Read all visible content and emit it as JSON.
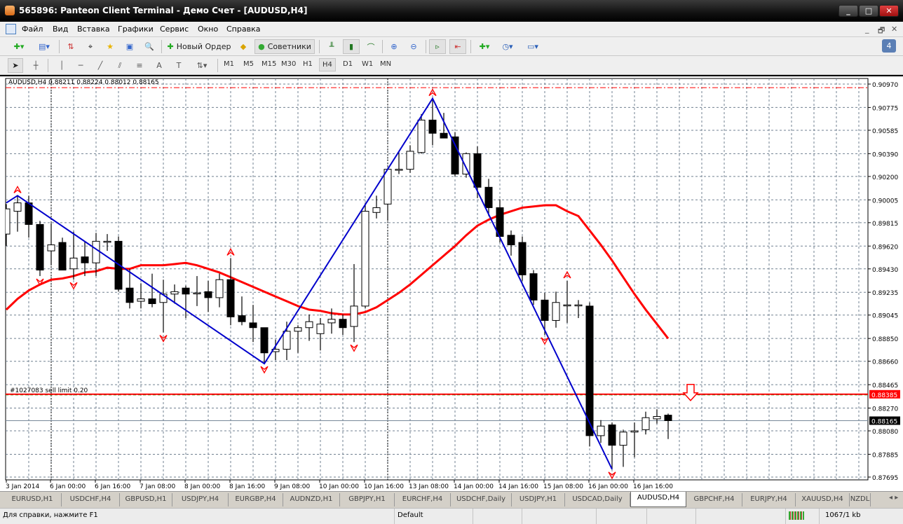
{
  "window": {
    "title": "565896: Panteon Client Terminal - Демо Счет - [AUDUSD,H4]",
    "minimize": "_",
    "maximize": "□",
    "close": "✕"
  },
  "menu": {
    "items": [
      "Файл",
      "Вид",
      "Вставка",
      "Графики",
      "Сервис",
      "Окно",
      "Справка"
    ],
    "child_controls": [
      "_",
      "🗗",
      "✕"
    ]
  },
  "toolbar": {
    "new_order": "Новый Ордер",
    "experts": "Советники",
    "notifications_count": "4"
  },
  "timeframes": [
    "M1",
    "M5",
    "M15",
    "M30",
    "H1",
    "H4",
    "D1",
    "W1",
    "MN"
  ],
  "active_timeframe": "H4",
  "colors": {
    "bull": "#ffffff",
    "bear": "#000000",
    "ma": "#ff0000",
    "zigzag": "#0000cc",
    "grid": "#708090",
    "order_line": "#ff0000"
  },
  "chart_data": {
    "type": "candlestick",
    "header": "AUDUSD,H4  0.88211 0.88224 0.88012 0.88165",
    "symbol": "AUDUSD,H4",
    "ylim": [
      0.87695,
      0.9097
    ],
    "y_ticks": [
      "0.90970",
      "0.90775",
      "0.90585",
      "0.90390",
      "0.90200",
      "0.90005",
      "0.89815",
      "0.89620",
      "0.89430",
      "0.89235",
      "0.89045",
      "0.88850",
      "0.88660",
      "0.88465",
      "0.88270",
      "0.88080",
      "0.87885",
      "0.87695"
    ],
    "x_ticks": [
      "3 Jan 2014",
      "6 Jan 00:00",
      "6 Jan 16:00",
      "7 Jan 08:00",
      "8 Jan 00:00",
      "8 Jan 16:00",
      "9 Jan 08:00",
      "10 Jan 00:00",
      "10 Jan 16:00",
      "13 Jan 08:00",
      "14 Jan 00:00",
      "14 Jan 16:00",
      "15 Jan 08:00",
      "16 Jan 00:00",
      "16 Jan 16:00"
    ],
    "candles_ohlc": [
      [
        0.8972,
        0.8997,
        0.8962,
        0.8993
      ],
      [
        0.8991,
        0.9004,
        0.8974,
        0.8998
      ],
      [
        0.8998,
        0.9004,
        0.8969,
        0.898
      ],
      [
        0.898,
        0.8983,
        0.8937,
        0.8942
      ],
      [
        0.8958,
        0.8981,
        0.8946,
        0.8963
      ],
      [
        0.8965,
        0.8969,
        0.8942,
        0.8942
      ],
      [
        0.8943,
        0.8974,
        0.8934,
        0.8952
      ],
      [
        0.8953,
        0.8966,
        0.8937,
        0.8948
      ],
      [
        0.8948,
        0.8973,
        0.8937,
        0.8966
      ],
      [
        0.8966,
        0.8972,
        0.8958,
        0.8966
      ],
      [
        0.8966,
        0.897,
        0.8924,
        0.8926
      ],
      [
        0.8927,
        0.8943,
        0.891,
        0.8915
      ],
      [
        0.8916,
        0.8931,
        0.891,
        0.8918
      ],
      [
        0.8918,
        0.8939,
        0.8911,
        0.8914
      ],
      [
        0.8915,
        0.8934,
        0.889,
        0.8922
      ],
      [
        0.8922,
        0.893,
        0.8914,
        0.8924
      ],
      [
        0.8927,
        0.8929,
        0.8902,
        0.8922
      ],
      [
        0.8923,
        0.8937,
        0.8912,
        0.8923
      ],
      [
        0.8924,
        0.8933,
        0.8907,
        0.8919
      ],
      [
        0.8919,
        0.8939,
        0.8911,
        0.8934
      ],
      [
        0.8934,
        0.8952,
        0.8896,
        0.8903
      ],
      [
        0.8904,
        0.892,
        0.8896,
        0.8899
      ],
      [
        0.8898,
        0.8913,
        0.8882,
        0.8894
      ],
      [
        0.8894,
        0.8894,
        0.8864,
        0.8873
      ],
      [
        0.8874,
        0.8884,
        0.8867,
        0.8876
      ],
      [
        0.8876,
        0.8899,
        0.8867,
        0.8891
      ],
      [
        0.8891,
        0.8896,
        0.8873,
        0.8894
      ],
      [
        0.8894,
        0.8905,
        0.8883,
        0.8899
      ],
      [
        0.8889,
        0.8902,
        0.8875,
        0.8897
      ],
      [
        0.8898,
        0.891,
        0.8889,
        0.8901
      ],
      [
        0.8901,
        0.8905,
        0.8888,
        0.8894
      ],
      [
        0.8895,
        0.8947,
        0.8882,
        0.8912
      ],
      [
        0.8912,
        0.8998,
        0.891,
        0.8991
      ],
      [
        0.899,
        0.9004,
        0.8985,
        0.8994
      ],
      [
        0.8997,
        0.9027,
        0.8983,
        0.9026
      ],
      [
        0.9026,
        0.904,
        0.9022,
        0.9026
      ],
      [
        0.9026,
        0.9046,
        0.9023,
        0.9041
      ],
      [
        0.904,
        0.9072,
        0.9039,
        0.9067
      ],
      [
        0.9067,
        0.9085,
        0.9046,
        0.9056
      ],
      [
        0.9056,
        0.9073,
        0.9052,
        0.9052
      ],
      [
        0.9053,
        0.9057,
        0.902,
        0.9022
      ],
      [
        0.9022,
        0.904,
        0.9019,
        0.9039
      ],
      [
        0.9039,
        0.9045,
        0.9002,
        0.9011
      ],
      [
        0.9011,
        0.9018,
        0.8987,
        0.8994
      ],
      [
        0.8994,
        0.9001,
        0.8965,
        0.897
      ],
      [
        0.8971,
        0.8975,
        0.8954,
        0.8963
      ],
      [
        0.8965,
        0.897,
        0.8933,
        0.8938
      ],
      [
        0.8939,
        0.8942,
        0.8913,
        0.8917
      ],
      [
        0.8917,
        0.8923,
        0.8888,
        0.89
      ],
      [
        0.89,
        0.8924,
        0.8894,
        0.8915
      ],
      [
        0.8913,
        0.8933,
        0.8898,
        0.8913
      ],
      [
        0.8913,
        0.8917,
        0.8902,
        0.8913
      ],
      [
        0.8912,
        0.8915,
        0.8795,
        0.8804
      ],
      [
        0.8804,
        0.8817,
        0.8798,
        0.8812
      ],
      [
        0.8813,
        0.8815,
        0.8776,
        0.8796
      ],
      [
        0.8796,
        0.8809,
        0.8778,
        0.8807
      ],
      [
        0.8807,
        0.8815,
        0.8786,
        0.8808
      ],
      [
        0.8809,
        0.8824,
        0.8805,
        0.8819
      ],
      [
        0.8818,
        0.8826,
        0.8814,
        0.882
      ],
      [
        0.88211,
        0.88224,
        0.88012,
        0.88165
      ]
    ],
    "moving_average": [
      0.8909,
      0.8918,
      0.8925,
      0.893,
      0.8934,
      0.8935,
      0.8937,
      0.894,
      0.8941,
      0.8944,
      0.8943,
      0.8943,
      0.8946,
      0.8946,
      0.8946,
      0.8947,
      0.8948,
      0.8946,
      0.8943,
      0.894,
      0.8936,
      0.8932,
      0.8928,
      0.8924,
      0.892,
      0.8916,
      0.8912,
      0.8909,
      0.8908,
      0.8906,
      0.8905,
      0.8905,
      0.8907,
      0.8911,
      0.8917,
      0.8923,
      0.893,
      0.8938,
      0.8946,
      0.8954,
      0.8962,
      0.8971,
      0.8979,
      0.8984,
      0.8988,
      0.8991,
      0.8994,
      0.8995,
      0.8996,
      0.8996,
      0.8991,
      0.8987,
      0.8975,
      0.8963,
      0.895,
      0.8936,
      0.8922,
      0.8909,
      0.8897,
      0.8885
    ],
    "zigzag": [
      [
        0,
        0.8998
      ],
      [
        1,
        0.9004
      ],
      [
        23,
        0.8864
      ],
      [
        38,
        0.9085
      ],
      [
        54,
        0.8776
      ]
    ],
    "fractal_up": [
      1,
      20,
      38,
      50
    ],
    "fractal_down": [
      3,
      6,
      14,
      23,
      31,
      48,
      54
    ],
    "current_price": "0.88165",
    "order": {
      "label": "#1027083 sell limit 0.20",
      "price": "0.88385"
    },
    "top_level_price": 0.9094
  },
  "tabs": [
    "EURUSD,H1",
    "USDCHF,H4",
    "GBPUSD,H1",
    "USDJPY,H4",
    "EURGBP,H4",
    "AUDNZD,H1",
    "GBPJPY,H1",
    "EURCHF,H4",
    "USDCHF,Daily",
    "USDJPY,H1",
    "USDCAD,Daily",
    "AUDUSD,H4",
    "GBPCHF,H4",
    "EURJPY,H4",
    "XAUUSD,H4",
    "NZDL"
  ],
  "active_tab": "AUDUSD,H4",
  "status": {
    "help": "Для справки, нажмите F1",
    "profile": "Default",
    "traffic": "1067/1 kb"
  }
}
